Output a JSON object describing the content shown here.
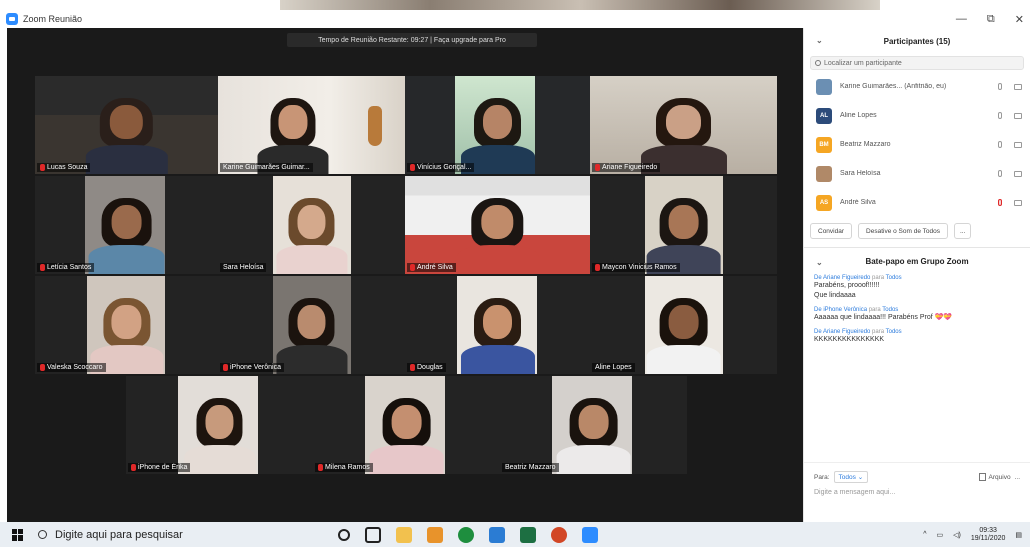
{
  "window": {
    "title": "Zoom Reunião",
    "controls": [
      "—",
      "⧉",
      "✕"
    ]
  },
  "banner": "Tempo de Reunião Restante: 09:27 | Faça upgrade para Pro",
  "tiles": [
    {
      "name": "Lucas Souza",
      "muted": true
    },
    {
      "name": "Karine Guimarães Guimar...",
      "muted": false
    },
    {
      "name": "Vinícius Gonçal...",
      "muted": true
    },
    {
      "name": "Ariane Figueiredo",
      "muted": true
    },
    {
      "name": "Letícia Santos",
      "muted": true
    },
    {
      "name": "Sara Heloísa",
      "muted": false
    },
    {
      "name": "André Silva",
      "muted": true
    },
    {
      "name": "Maycon Vinicius Ramos",
      "muted": true
    },
    {
      "name": "Valeska Scoccaro",
      "muted": true
    },
    {
      "name": "iPhone Verônica",
      "muted": true
    },
    {
      "name": "Douglas",
      "muted": true
    },
    {
      "name": "Aline Lopes",
      "muted": false
    },
    {
      "name": "iPhone de Érika",
      "muted": true
    },
    {
      "name": "Milena Ramos",
      "muted": true
    },
    {
      "name": "Beatriz Mazzaro",
      "muted": false
    }
  ],
  "participants": {
    "title": "Participantes (15)",
    "search_placeholder": "Localizar um participante",
    "items": [
      {
        "name": "Karine Guimarães... (Anfitrião, eu)",
        "initials": "",
        "color": "#6b8fb3",
        "mic_muted": false
      },
      {
        "name": "Aline Lopes",
        "initials": "AL",
        "color": "#2c4b7a",
        "mic_muted": false
      },
      {
        "name": "Beatriz Mazzaro",
        "initials": "BM",
        "color": "#f5a623",
        "mic_muted": false
      },
      {
        "name": "Sara Heloísa",
        "initials": "",
        "color": "#b08968",
        "mic_muted": false
      },
      {
        "name": "André Silva",
        "initials": "AS",
        "color": "#f5a623",
        "mic_muted": true
      }
    ],
    "invite_label": "Convidar",
    "mute_all_label": "Desative o Som de Todos",
    "more_label": "..."
  },
  "chat": {
    "title": "Bate-papo em Grupo Zoom",
    "messages": [
      {
        "from": "De Ariane Figueiredo",
        "to": "Todos",
        "lines": [
          "Parabéns, prooof!!!!!!",
          "Que lindaaaa"
        ]
      },
      {
        "from": "De iPhone Verônica",
        "to": "Todos",
        "lines": [
          "Aaaaaa que lindaaaa!!! Parabéns Prof 💝💝"
        ]
      },
      {
        "from": "De Ariane Figueiredo",
        "to": "Todos",
        "lines": [
          "KKKKKKKKKKKKKKK"
        ]
      }
    ],
    "to_label": "Para:",
    "to_value": "Todos ⌄",
    "file_label": "Arquivo",
    "more_label": "...",
    "input_placeholder": "Digite a mensagem aqui..."
  },
  "taskbar": {
    "search_placeholder": "Digite aqui para pesquisar",
    "time": "09:33",
    "date": "19/11/2020"
  }
}
